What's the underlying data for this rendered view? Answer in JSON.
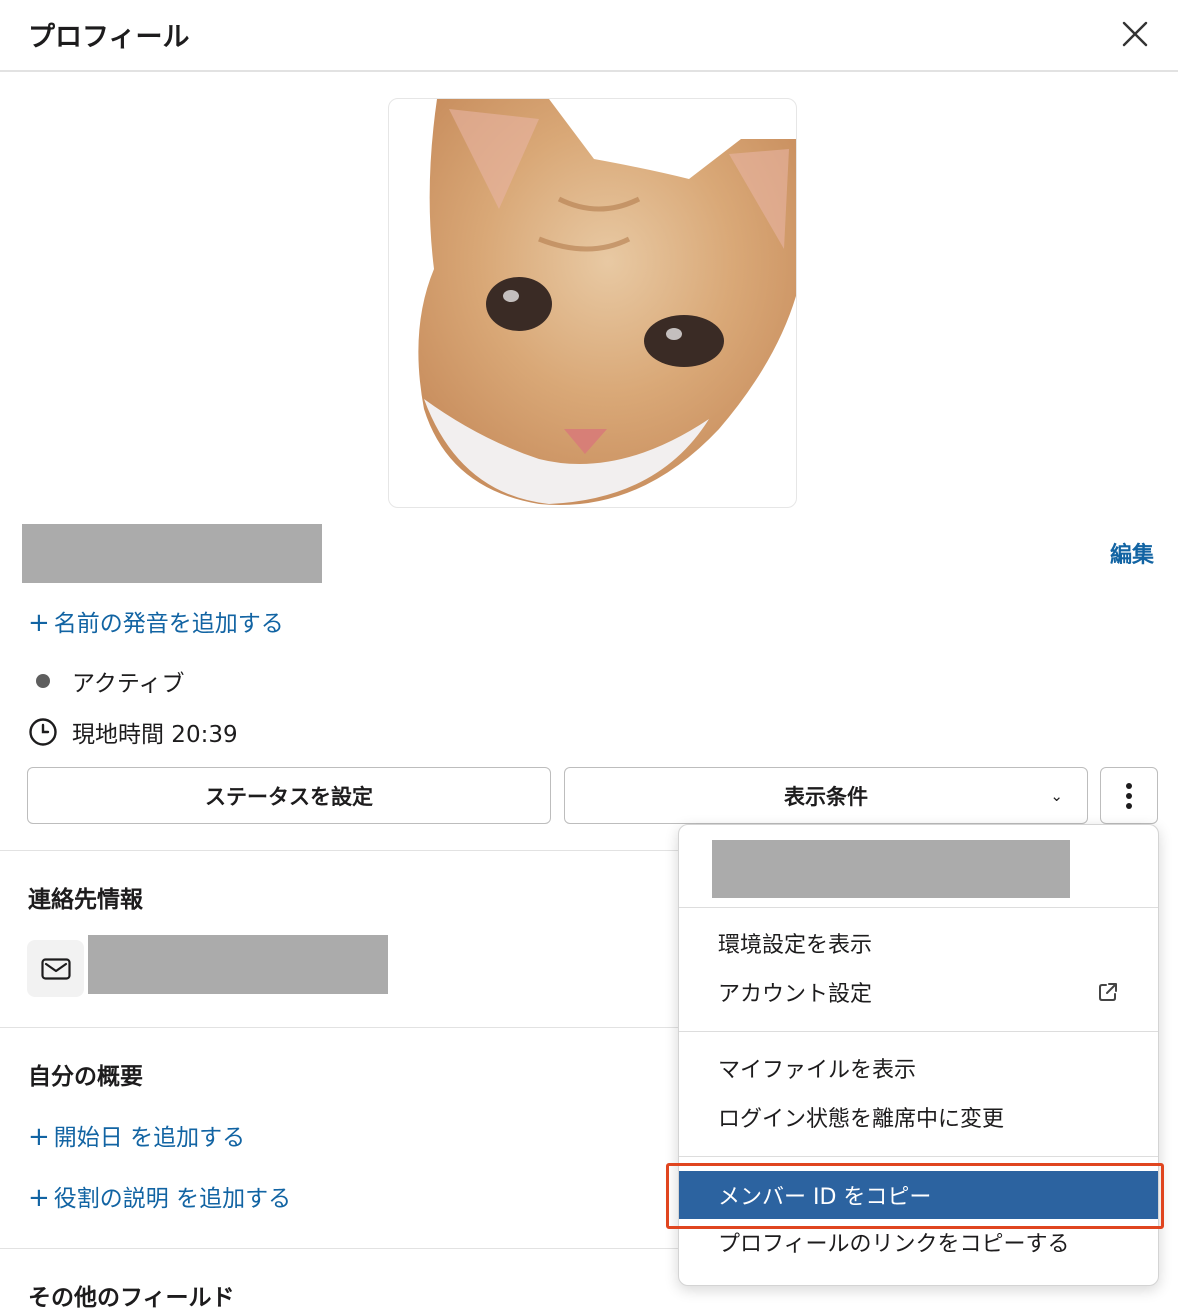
{
  "header": {
    "title": "プロフィール"
  },
  "profile": {
    "edit_label": "編集",
    "add_pronunciation": "名前の発音を追加する",
    "status_text": "アクティブ",
    "local_time": "現地時間 20:39",
    "set_status_button": "ステータスを設定",
    "view_options_button": "表示条件"
  },
  "contact": {
    "title": "連絡先情報"
  },
  "about": {
    "title": "自分の概要",
    "add_start_date": "開始日 を追加する",
    "add_role": "役割の説明 を追加する"
  },
  "other": {
    "title": "その他のフィールド"
  },
  "menu": {
    "items": [
      {
        "label": "環境設定を表示"
      },
      {
        "label": "アカウント設定"
      },
      {
        "label": "マイファイルを表示"
      },
      {
        "label": "ログイン状態を離席中に変更"
      },
      {
        "label": "メンバー ID をコピー"
      },
      {
        "label": "プロフィールのリンクをコピーする"
      }
    ],
    "highlight_color": "#2c63a0",
    "annotation_color": "#e0451f"
  },
  "colors": {
    "link": "#1264a3",
    "redaction": "#ababab"
  },
  "icons": [
    "close-icon",
    "cat-avatar",
    "plus-icon",
    "status-dot-icon",
    "clock-icon",
    "chevron-down-icon",
    "more-vertical-icon",
    "mail-icon",
    "external-link-icon"
  ]
}
